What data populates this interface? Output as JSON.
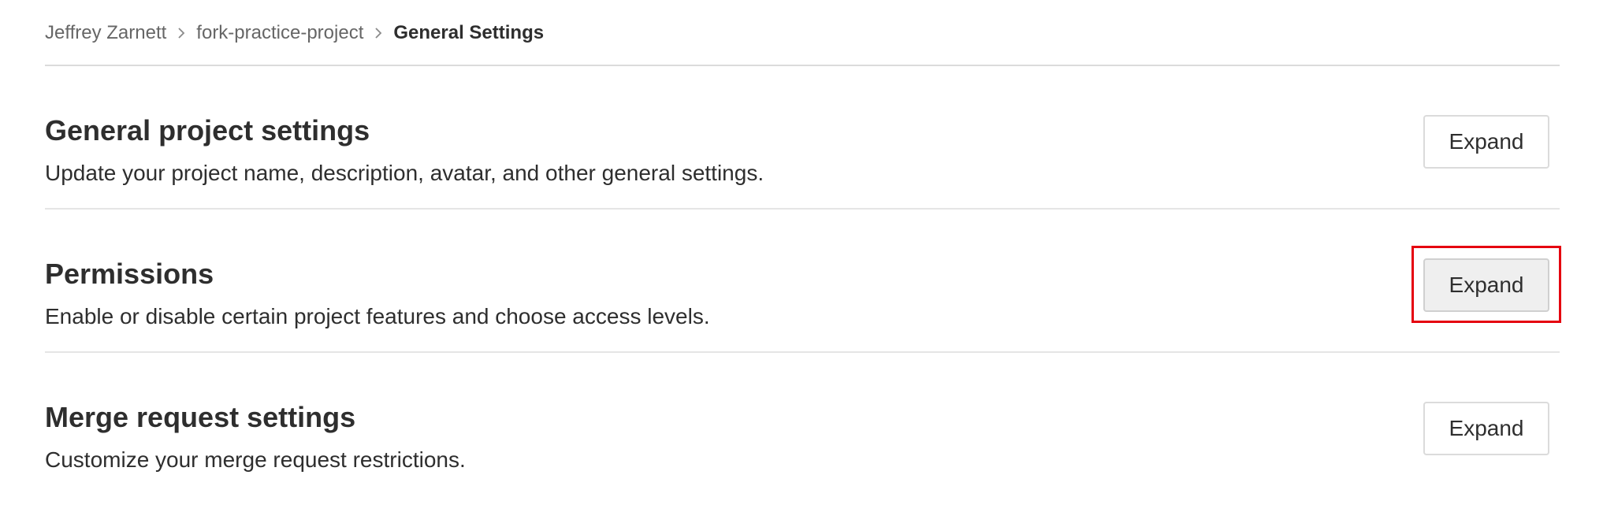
{
  "breadcrumb": {
    "items": [
      {
        "label": "Jeffrey Zarnett"
      },
      {
        "label": "fork-practice-project"
      }
    ],
    "current": "General Settings"
  },
  "sections": [
    {
      "title": "General project settings",
      "description": "Update your project name, description, avatar, and other general settings.",
      "button_label": "Expand"
    },
    {
      "title": "Permissions",
      "description": "Enable or disable certain project features and choose access levels.",
      "button_label": "Expand"
    },
    {
      "title": "Merge request settings",
      "description": "Customize your merge request restrictions.",
      "button_label": "Expand"
    }
  ],
  "highlight": {
    "color": "#e5000f"
  },
  "colors": {
    "text": "#2e2e2e",
    "muted": "#666666",
    "border": "#dbdbdb"
  }
}
